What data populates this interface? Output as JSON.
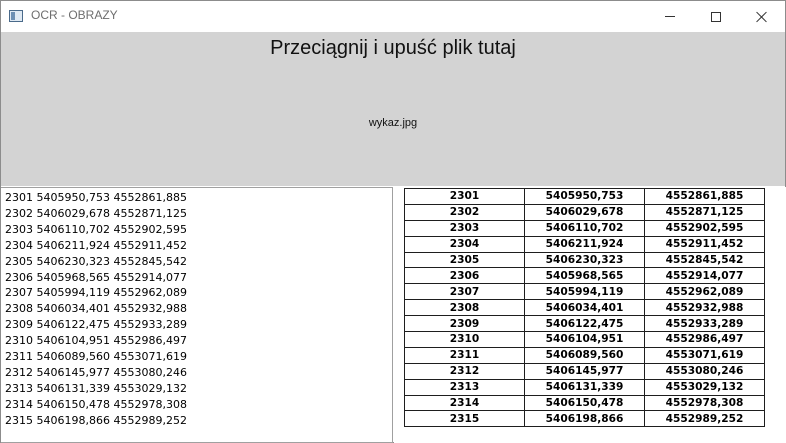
{
  "window": {
    "title": "OCR - OBRAZY",
    "controls": [
      "minimize",
      "maximize",
      "close"
    ]
  },
  "dropzone": {
    "heading": "Przeciągnij i upuść plik tutaj",
    "file_name": "wykaz.jpg"
  },
  "text_output": {
    "lines": [
      "2301 5405950,753 4552861,885",
      "2302 5406029,678 4552871,125",
      "2303 5406110,702 4552902,595",
      "2304 5406211,924 4552911,452",
      "2305 5406230,323 4552845,542",
      "2306 5405968,565 4552914,077",
      "2307 5405994,119 4552962,089",
      "2308 5406034,401 4552932,988",
      "2309 5406122,475 4552933,289",
      "2310 5406104,951 4552986,497",
      "2311 5406089,560 4553071,619",
      "2312 5406145,977 4553080,246",
      "2313 5406131,339 4553029,132",
      "2314 5406150,478 4552978,308",
      "2315 5406198,866 4552989,252"
    ]
  },
  "table": {
    "rows": [
      [
        "2301",
        "5405950,753",
        "4552861,885"
      ],
      [
        "2302",
        "5406029,678",
        "4552871,125"
      ],
      [
        "2303",
        "5406110,702",
        "4552902,595"
      ],
      [
        "2304",
        "5406211,924",
        "4552911,452"
      ],
      [
        "2305",
        "5406230,323",
        "4552845,542"
      ],
      [
        "2306",
        "5405968,565",
        "4552914,077"
      ],
      [
        "2307",
        "5405994,119",
        "4552962,089"
      ],
      [
        "2308",
        "5406034,401",
        "4552932,988"
      ],
      [
        "2309",
        "5406122,475",
        "4552933,289"
      ],
      [
        "2310",
        "5406104,951",
        "4552986,497"
      ],
      [
        "2311",
        "5406089,560",
        "4553071,619"
      ],
      [
        "2312",
        "5406145,977",
        "4553080,246"
      ],
      [
        "2313",
        "5406131,339",
        "4553029,132"
      ],
      [
        "2314",
        "5406150,478",
        "4552978,308"
      ],
      [
        "2315",
        "5406198,866",
        "4552989,252"
      ]
    ]
  },
  "colors": {
    "dropzone_bg": "#d3d3d3",
    "title_text": "#6e6e6e",
    "window_border": "#8c8c8c"
  }
}
